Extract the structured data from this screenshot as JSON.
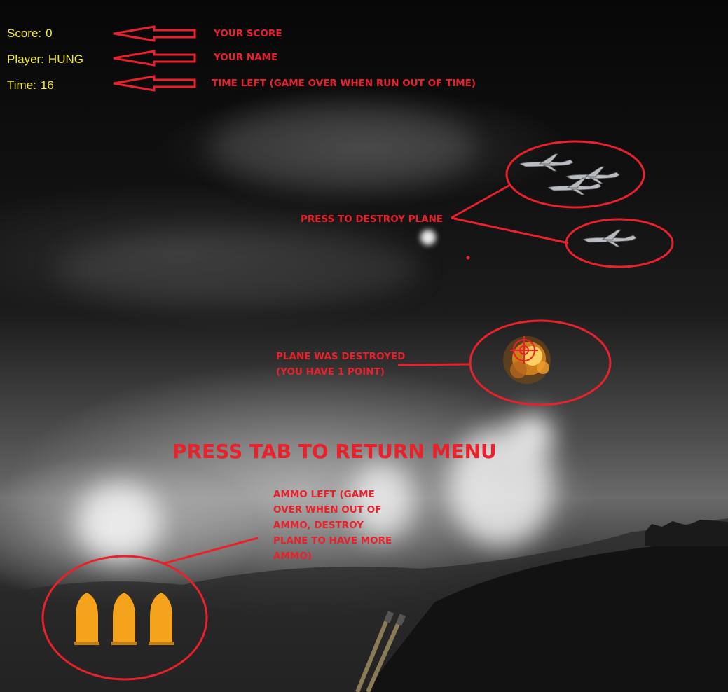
{
  "hud": {
    "score_label": "Score:",
    "score_value": "0",
    "player_label": "Player:",
    "player_value": "HUNG",
    "time_label": "Time:",
    "time_value": "16"
  },
  "annotations": {
    "score_note": "YOUR SCORE",
    "name_note": "YOUR NAME",
    "time_note": "TIME LEFT (GAME OVER WHEN RUN OUT OF TIME)",
    "destroy_note": "PRESS TO DESTROY PLANE",
    "destroyed_line1": "PLANE WAS DESTROYED",
    "destroyed_line2": "(YOU HAVE 1 POINT)",
    "tab_prompt": "PRESS TAB TO RETURN MENU",
    "ammo_line1": "AMMO LEFT (GAME",
    "ammo_line2": "OVER WHEN OUT OF",
    "ammo_line3": "AMMO, DESTROY",
    "ammo_line4": "PLANE TO HAVE MORE",
    "ammo_line5": "AMMO)"
  },
  "game": {
    "ammo_count": 3,
    "enemy_planes_visible": 4
  },
  "colors": {
    "hud_text": "#f2ea3c",
    "annotation_red": "#e8212b",
    "ammo_bullet": "#f5a31c"
  }
}
